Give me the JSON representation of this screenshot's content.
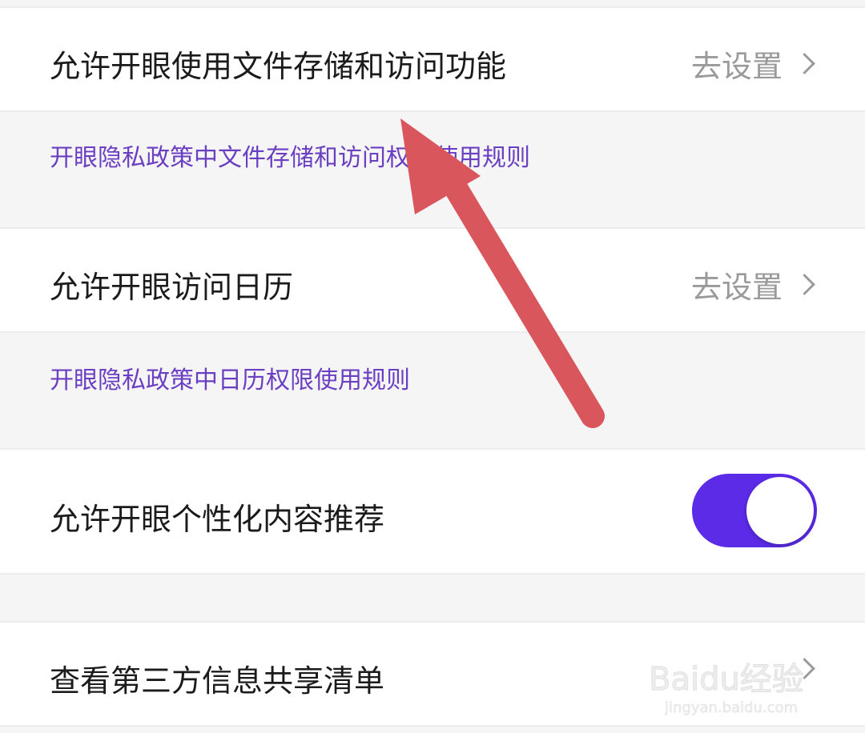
{
  "rows": {
    "file_storage": {
      "label": "允许开眼使用文件存储和访问功能",
      "action_label": "去设置",
      "policy_link": "开眼隐私政策中文件存储和访问权限使用规则"
    },
    "calendar": {
      "label": "允许开眼访问日历",
      "action_label": "去设置",
      "policy_link": "开眼隐私政策中日历权限使用规则"
    },
    "personalized": {
      "label": "允许开眼个性化内容推荐",
      "toggle_on": true
    },
    "third_party": {
      "label": "查看第三方信息共享清单"
    }
  },
  "colors": {
    "accent": "#5b2be8",
    "link": "#6b3fc2",
    "annotation_arrow": "#d9565c"
  },
  "watermark": {
    "brand": "Baidu经验",
    "url": "jingyan.baidu.com"
  }
}
